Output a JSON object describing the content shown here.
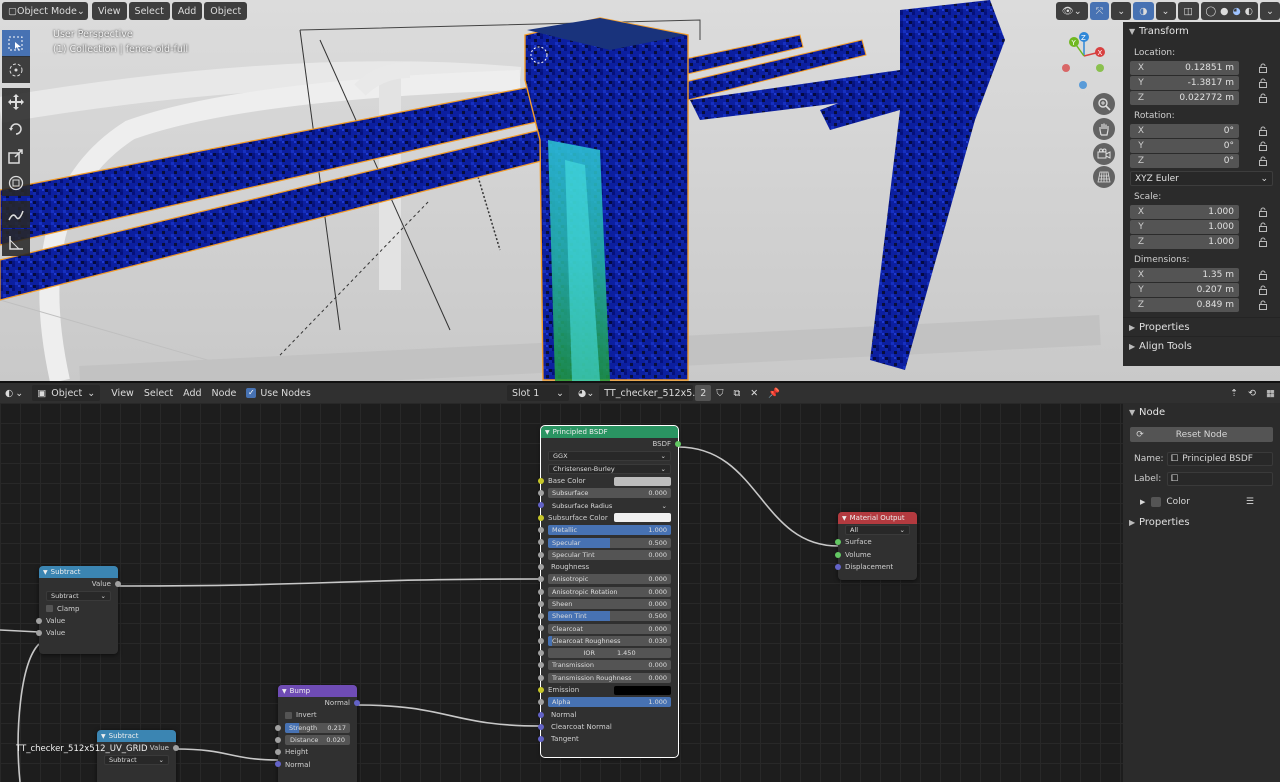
{
  "viewport": {
    "header": {
      "mode": "Object Mode",
      "menus": [
        "View",
        "Select",
        "Add",
        "Object"
      ]
    },
    "overlay": {
      "perspective": "User Perspective",
      "collection": "(1) Collection | fence-old-full"
    },
    "gizmo": {
      "x": "X",
      "y": "Y",
      "z": "Z"
    },
    "tools": [
      "select-box-icon",
      "cursor-icon",
      "move-icon",
      "rotate-icon",
      "scale-icon",
      "transform-icon",
      "annotate-icon",
      "measure-icon"
    ],
    "nav": [
      "zoom-icon",
      "hand-icon",
      "camera-icon",
      "grid-icon"
    ]
  },
  "transform_panel": {
    "title": "Transform",
    "location_label": "Location:",
    "location": [
      {
        "axis": "X",
        "value": "0.12851 m"
      },
      {
        "axis": "Y",
        "value": "-1.3817 m"
      },
      {
        "axis": "Z",
        "value": "0.022772 m"
      }
    ],
    "rotation_label": "Rotation:",
    "rotation": [
      {
        "axis": "X",
        "value": "0°"
      },
      {
        "axis": "Y",
        "value": "0°"
      },
      {
        "axis": "Z",
        "value": "0°"
      }
    ],
    "rotation_mode": "XYZ Euler",
    "scale_label": "Scale:",
    "scale": [
      {
        "axis": "X",
        "value": "1.000"
      },
      {
        "axis": "Y",
        "value": "1.000"
      },
      {
        "axis": "Z",
        "value": "1.000"
      }
    ],
    "dimensions_label": "Dimensions:",
    "dimensions": [
      {
        "axis": "X",
        "value": "1.35 m"
      },
      {
        "axis": "Y",
        "value": "0.207 m"
      },
      {
        "axis": "Z",
        "value": "0.849 m"
      }
    ],
    "properties": "Properties",
    "align_tools": "Align Tools"
  },
  "node_editor": {
    "header": {
      "object_type": "Object",
      "menus": [
        "View",
        "Select",
        "Add",
        "Node"
      ],
      "use_nodes": "Use Nodes",
      "slot": "Slot 1",
      "material": "TT_checker_512x5...",
      "users": "2"
    },
    "principled": {
      "title": "Principled BSDF",
      "output": "BSDF",
      "distribution": "GGX",
      "subsurface_method": "Christensen-Burley",
      "inputs": [
        {
          "label": "Base Color",
          "type": "color",
          "color": "#bdbdbd",
          "socket": "yellow"
        },
        {
          "label": "Subsurface",
          "value": "0.000",
          "fill": 0,
          "socket": "gray"
        },
        {
          "label": "Subsurface Radius",
          "type": "dropdown",
          "socket": "violet"
        },
        {
          "label": "Subsurface Color",
          "type": "color",
          "color": "#f0f0f0",
          "socket": "yellow"
        },
        {
          "label": "Metallic",
          "value": "1.000",
          "fill": 1,
          "socket": "gray"
        },
        {
          "label": "Specular",
          "value": "0.500",
          "fill": 0.5,
          "socket": "gray"
        },
        {
          "label": "Specular Tint",
          "value": "0.000",
          "fill": 0,
          "socket": "gray"
        },
        {
          "label": "Roughness",
          "type": "linked",
          "socket": "gray"
        },
        {
          "label": "Anisotropic",
          "value": "0.000",
          "fill": 0,
          "socket": "gray"
        },
        {
          "label": "Anisotropic Rotation",
          "value": "0.000",
          "fill": 0,
          "socket": "gray"
        },
        {
          "label": "Sheen",
          "value": "0.000",
          "fill": 0,
          "socket": "gray"
        },
        {
          "label": "Sheen Tint",
          "value": "0.500",
          "fill": 0.5,
          "socket": "gray"
        },
        {
          "label": "Clearcoat",
          "value": "0.000",
          "fill": 0,
          "socket": "gray"
        },
        {
          "label": "Clearcoat Roughness",
          "value": "0.030",
          "fill": 0.03,
          "socket": "gray"
        },
        {
          "label": "IOR",
          "value": "1.450",
          "fill": 0,
          "socket": "gray",
          "centered": true
        },
        {
          "label": "Transmission",
          "value": "0.000",
          "fill": 0,
          "socket": "gray"
        },
        {
          "label": "Transmission Roughness",
          "value": "0.000",
          "fill": 0,
          "socket": "gray"
        },
        {
          "label": "Emission",
          "type": "color",
          "color": "#000000",
          "socket": "yellow"
        },
        {
          "label": "Alpha",
          "value": "1.000",
          "fill": 1,
          "socket": "gray"
        },
        {
          "label": "Normal",
          "type": "linked",
          "socket": "violet"
        },
        {
          "label": "Clearcoat Normal",
          "type": "plain",
          "socket": "violet"
        },
        {
          "label": "Tangent",
          "type": "plain",
          "socket": "violet"
        }
      ]
    },
    "material_output": {
      "title": "Material Output",
      "target": "All",
      "inputs": [
        "Surface",
        "Volume",
        "Displacement"
      ]
    },
    "subtract1": {
      "title": "Subtract",
      "output": "Value",
      "operation": "Subtract",
      "clamp": "Clamp",
      "inputs": [
        "Value",
        "Value"
      ]
    },
    "bump": {
      "title": "Bump",
      "output": "Normal",
      "invert": "Invert",
      "strength_label": "Strength",
      "strength": "0.217",
      "strength_fill": 0.217,
      "distance_label": "Distance",
      "distance": "0.020",
      "inputs": [
        "Height",
        "Normal"
      ]
    },
    "subtract2": {
      "title": "Subtract",
      "output": "Value",
      "operation": "Subtract"
    },
    "frame_label": "TT_checker_512x512_UV_GRID"
  },
  "node_sidebar": {
    "title": "Node",
    "reset": "Reset Node",
    "name_label": "Name:",
    "name_value": "Principled BSDF",
    "label_label": "Label:",
    "label_value": "",
    "color": "Color",
    "properties": "Properties"
  },
  "colors": {
    "accent": "#4772b3",
    "shader_header": "#2a9462",
    "output_header": "#b33a3f",
    "converter_header": "#3b85b2",
    "vector_header": "#6f4cb5",
    "object_blue": "#0a1e8a",
    "selection_orange": "#f39c28"
  }
}
